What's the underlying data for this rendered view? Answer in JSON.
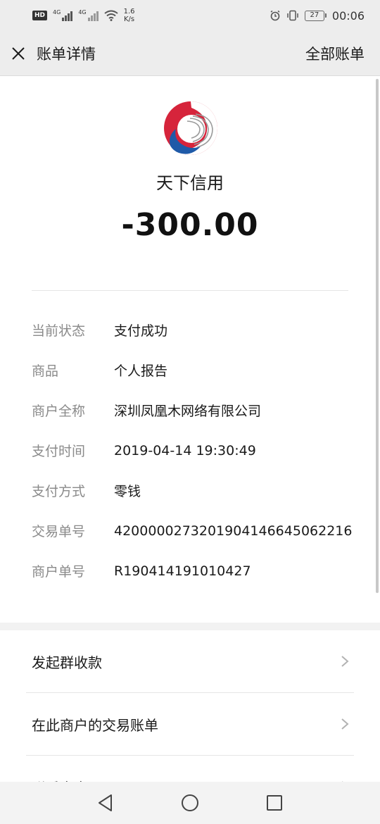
{
  "status_bar": {
    "network_1": "4G",
    "network_2": "4G",
    "speed_value": "1.6",
    "speed_unit": "K/s",
    "battery": "27",
    "time": "00:06"
  },
  "nav": {
    "title": "账单详情",
    "right_link": "全部账单"
  },
  "hero": {
    "merchant": "天下信用",
    "amount": "-300.00"
  },
  "details": [
    {
      "label": "当前状态",
      "value": "支付成功"
    },
    {
      "label": "商品",
      "value": "个人报告"
    },
    {
      "label": "商户全称",
      "value": "深圳凤凰木网络有限公司"
    },
    {
      "label": "支付时间",
      "value": "2019-04-14 19:30:49"
    },
    {
      "label": "支付方式",
      "value": "零钱"
    },
    {
      "label": "交易单号",
      "value": "4200000273201904146645062216"
    },
    {
      "label": "商户单号",
      "value": "R190414191010427"
    }
  ],
  "actions": [
    {
      "label": "发起群收款"
    },
    {
      "label": "在此商户的交易账单"
    },
    {
      "label": "联系商户"
    }
  ],
  "colors": {
    "logo_red": "#d6243b",
    "logo_blue": "#1f5aa8",
    "background_gray": "#ededed"
  }
}
